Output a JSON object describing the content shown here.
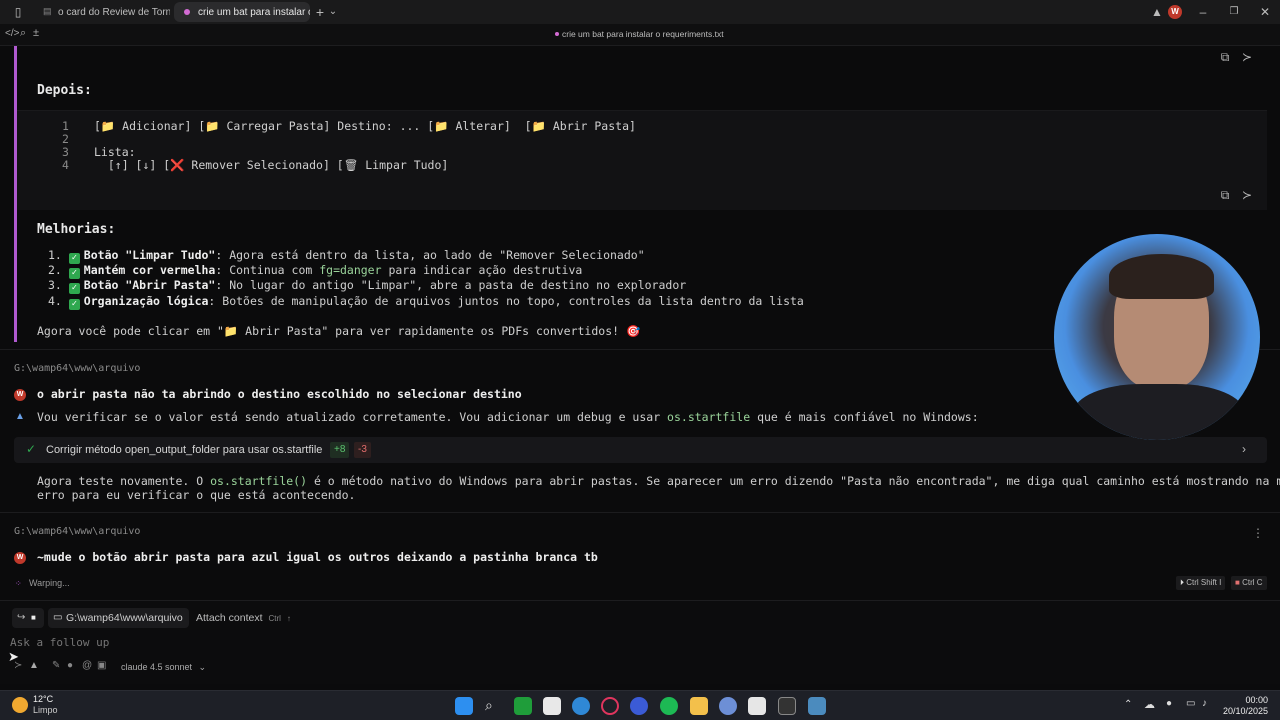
{
  "titlebar": {
    "tabs": [
      {
        "label": "o card do Review de Torneios"
      },
      {
        "label": "crie um bat para instalar o req"
      }
    ],
    "new_tab": "+",
    "dropdown": "⌄",
    "avatar": "W"
  },
  "subbar": {
    "file_title": "crie um bat para instalar o requeriments.txt"
  },
  "conversation": {
    "depois_heading": "Depois:",
    "code_lines": [
      {
        "num": "1",
        "text": "[📁 Adicionar] [📁 Carregar Pasta] Destino: ... [📁 Alterar]  [📁 Abrir Pasta]"
      },
      {
        "num": "2",
        "text": ""
      },
      {
        "num": "3",
        "text": "Lista:"
      },
      {
        "num": "4",
        "text": "  [↑] [↓] [❌ Remover Selecionado] [🗑 Limpar Tudo]"
      }
    ],
    "melhorias_heading": "Melhorias:",
    "improvements": [
      {
        "n": "1.",
        "title": "Botão \"Limpar Tudo\"",
        "pre": ": Agora está dentro da lista, ao lado de \"Remover Selecionado\"",
        "kw": "",
        "post": ""
      },
      {
        "n": "2.",
        "title": "Mantém cor vermelha",
        "pre": ": Continua com ",
        "kw": "fg=danger",
        "post": " para indicar ação destrutiva"
      },
      {
        "n": "3.",
        "title": "Botão \"Abrir Pasta\"",
        "pre": ": No lugar do antigo \"Limpar\", abre a pasta de destino no explorador",
        "kw": "",
        "post": ""
      },
      {
        "n": "4.",
        "title": "Organização lógica",
        "pre": ": Botões de manipulação de arquivos juntos no topo, controles da lista dentro da lista",
        "kw": "",
        "post": ""
      }
    ],
    "summary": "Agora você pode clicar em \"📁 Abrir Pasta\" para ver rapidamente os PDFs convertidos! 🎯",
    "path1": "G:\\wamp64\\www\\arquivo",
    "user_msg1": "o abrir pasta não ta abrindo o destino escolhido no selecionar destino",
    "agent_pre": "Vou verificar se o valor está sendo atualizado corretamente. Vou adicionar um debug e usar ",
    "agent_kw": "os.startfile",
    "agent_post": " que é mais confiável no Windows:",
    "diff_title": "Corrigir método open_output_folder para usar os.startfile",
    "diff_add": "+8",
    "diff_del": "-3",
    "test_pre": "Agora teste novamente. O ",
    "test_kw": "os.startfile()",
    "test_post": " é o método nativo do Windows para abrir pastas. Se aparecer um erro dizendo \"Pasta não encontrada\", me diga qual caminho está mostrando na mensagem de",
    "test_line2": "erro para eu verificar o que está acontecendo.",
    "path2": "G:\\wamp64\\www\\arquivo",
    "user_msg2": "~mude o botão abrir pasta para azul igual os outros deixando a pastinha branca tb",
    "status": "Warping...",
    "shortcut1": "Ctrl Shift I",
    "shortcut2": "Ctrl C",
    "user_badge": "W"
  },
  "input": {
    "folder_chip": "G:\\wamp64\\www\\arquivo",
    "attach_label": "Attach context",
    "attach_key": "Ctrl",
    "attach_key2": "↑",
    "placeholder": "Ask a follow up",
    "model": "claude 4.5 sonnet"
  },
  "taskbar": {
    "temp": "12°C",
    "weather": "Limpo",
    "time": "00:00",
    "date": "20/10/2025"
  },
  "colors": {
    "accent": "#b05ad0",
    "check": "#2fa84f",
    "keyword": "#9ad39a",
    "user_dot": "#c0392b"
  }
}
